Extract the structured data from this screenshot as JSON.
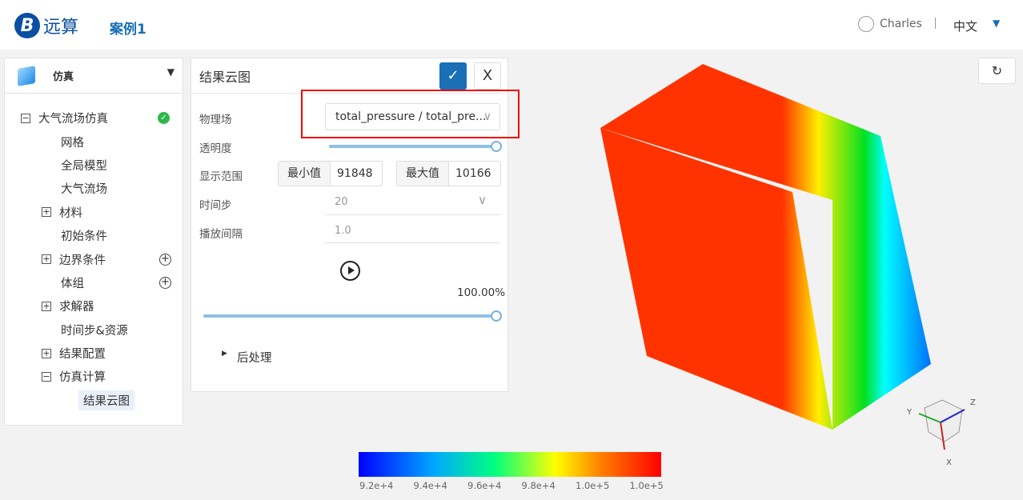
{
  "header": {
    "logo_text": "远算",
    "project": "案例1",
    "user": "Charles",
    "language": "中文"
  },
  "sidebar": {
    "module": "仿真",
    "items": [
      {
        "label": "大气流场仿真",
        "toggle": "−",
        "status": "ok"
      },
      {
        "label": "网格"
      },
      {
        "label": "全局模型"
      },
      {
        "label": "大气流场"
      },
      {
        "label": "材料",
        "toggle": "+"
      },
      {
        "label": "初始条件"
      },
      {
        "label": "边界条件",
        "toggle": "+",
        "add": true
      },
      {
        "label": "体组",
        "add": true
      },
      {
        "label": "求解器",
        "toggle": "+"
      },
      {
        "label": "时间步&资源"
      },
      {
        "label": "结果配置",
        "toggle": "+"
      },
      {
        "label": "仿真计算",
        "toggle": "−"
      },
      {
        "label": "结果云图",
        "selected": true
      }
    ]
  },
  "panel": {
    "title": "结果云图",
    "confirm": "✓",
    "close": "X",
    "field_label": "物理场",
    "field_value": "total_pressure / total_pre...",
    "opacity_label": "透明度",
    "opacity": 1.0,
    "range_label": "显示范围",
    "min_label": "最小值",
    "min_value": "91848",
    "max_label": "最大值",
    "max_value": "10166",
    "timestep_label": "时间步",
    "timestep_value": "20",
    "interval_label": "播放间隔",
    "interval_value": "1.0",
    "progress_text": "100.00%",
    "progress": 1.0,
    "post_label": "后处理"
  },
  "viewport": {
    "axes": {
      "x": "X",
      "y": "Y",
      "z": "Z"
    }
  },
  "legend": {
    "ticks": [
      "9.2e+4",
      "9.4e+4",
      "9.6e+4",
      "9.8e+4",
      "1.0e+5",
      "1.0e+5"
    ],
    "colors": [
      "#0000ff",
      "#00a8ff",
      "#00ff80",
      "#ffff00",
      "#ff8000",
      "#ff0000"
    ]
  }
}
